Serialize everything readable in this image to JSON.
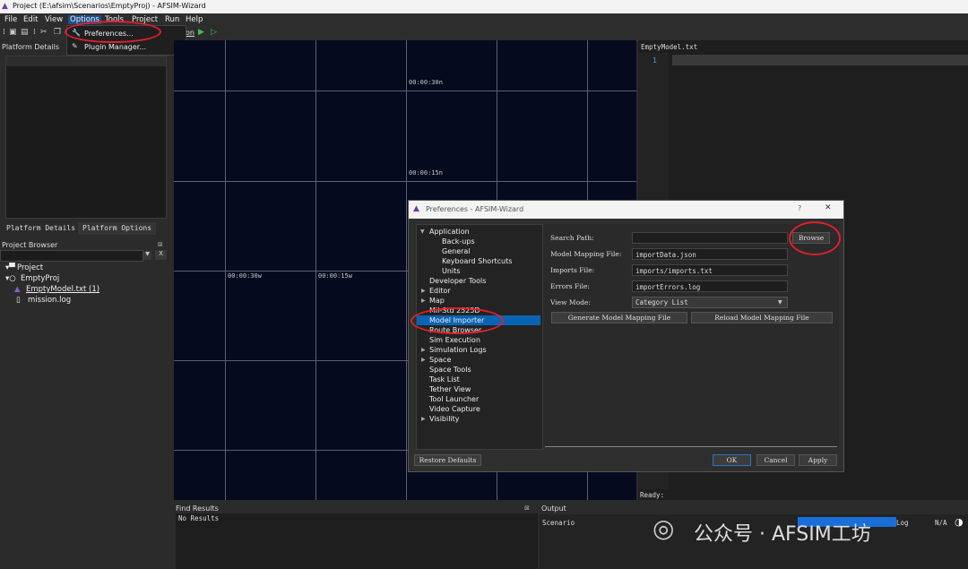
{
  "window": {
    "title": "Project (E:\\afsim\\Scenarios\\EmptyProj) - AFSIM-Wizard"
  },
  "menu": [
    "File",
    "Edit",
    "View",
    "Options",
    "Tools",
    "Project",
    "Run",
    "Help"
  ],
  "options_menu": {
    "items": [
      "Preferences...",
      "Plugin Manager..."
    ]
  },
  "toolbar": {
    "run_label": "on"
  },
  "platform_details": {
    "title": "Platform Details",
    "tabs": [
      "Platform Details",
      "Platform Options"
    ]
  },
  "project_browser": {
    "title": "Project Browser",
    "filter_clear": "X",
    "tree": {
      "root": "Project",
      "proj": "EmptyProj",
      "file1": "EmptyModel.txt (1)",
      "file2": "mission.log"
    }
  },
  "map": {
    "labels": [
      "00:00:30n",
      "00:00:15n",
      "00:00:30w",
      "00:00:15w"
    ]
  },
  "editor": {
    "filename": "EmptyModel.txt",
    "line": "1",
    "status": "Ready:"
  },
  "find_results": {
    "title": "Find Results",
    "body": "No Results"
  },
  "output": {
    "title": "Output",
    "tab": "Scenario",
    "log_label": "Log",
    "log_value": "N/A"
  },
  "watermark": {
    "text": "公众号 · AFSIM工坊"
  },
  "dialog": {
    "title": "Preferences - AFSIM-Wizard",
    "help": "?",
    "close": "✕",
    "tree": [
      {
        "label": "Application",
        "level": 0,
        "expander": "▾"
      },
      {
        "label": "Back-ups",
        "level": 1
      },
      {
        "label": "General",
        "level": 1
      },
      {
        "label": "Keyboard Shortcuts",
        "level": 1
      },
      {
        "label": "Units",
        "level": 1
      },
      {
        "label": "Developer Tools",
        "level": 0
      },
      {
        "label": "Editor",
        "level": 0,
        "expander": "›"
      },
      {
        "label": "Map",
        "level": 0,
        "expander": "›"
      },
      {
        "label": "Mil-Std 2525D",
        "level": 0
      },
      {
        "label": "Model Importer",
        "level": 0,
        "selected": true
      },
      {
        "label": "Route Browser",
        "level": 0
      },
      {
        "label": "Sim Execution",
        "level": 0
      },
      {
        "label": "Simulation Logs",
        "level": 0,
        "expander": "›"
      },
      {
        "label": "Space",
        "level": 0,
        "expander": "›"
      },
      {
        "label": "Space Tools",
        "level": 0
      },
      {
        "label": "Task List",
        "level": 0
      },
      {
        "label": "Tether View",
        "level": 0
      },
      {
        "label": "Tool Launcher",
        "level": 0
      },
      {
        "label": "Video Capture",
        "level": 0
      },
      {
        "label": "Visibility",
        "level": 0,
        "expander": "›"
      }
    ],
    "fields": {
      "search_path": {
        "label": "Search Path:",
        "value": ""
      },
      "model_mapping": {
        "label": "Model Mapping File:",
        "value": "importData.json"
      },
      "imports_file": {
        "label": "Imports File:",
        "value": "imports/imports.txt"
      },
      "errors_file": {
        "label": "Errors File:",
        "value": "importErrors.log"
      },
      "view_mode": {
        "label": "View Mode:",
        "value": "Category List"
      }
    },
    "buttons": {
      "browse": "Browse",
      "generate": "Generate Model Mapping File",
      "reload": "Reload Model Mapping File",
      "restore": "Restore Defaults",
      "ok": "OK",
      "cancel": "Cancel",
      "apply": "Apply"
    }
  },
  "colors": {
    "annotation": "#e0202a",
    "selection": "#0a64b4",
    "map_bg": "#050a1f"
  }
}
